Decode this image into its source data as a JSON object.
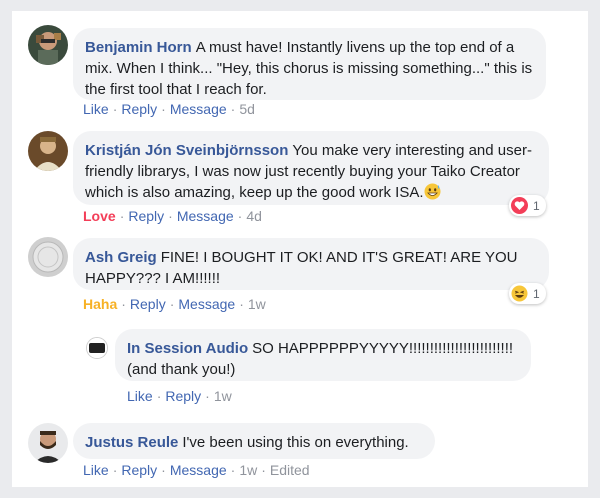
{
  "comments": [
    {
      "author": "Benjamin Horn",
      "text": "A must have! Instantly livens up the top end of a mix. When I think... \"Hey, this chorus is missing something...\" this is the first tool that I reach for.",
      "actions": {
        "like": "Like",
        "reply": "Reply",
        "message": "Message",
        "time": "5d"
      }
    },
    {
      "author": "Kristján Jón Sveinbjörnsson",
      "text": "You make very interesting and user-friendly librarys, I was now just recently buying your Taiko Creator which is also amazing, keep up the good work ISA.",
      "emoji": "grinning-sweat-emoji",
      "actions": {
        "reaction_label": "Love",
        "reply": "Reply",
        "message": "Message",
        "time": "4d"
      },
      "reaction": {
        "type": "heart-reaction-icon",
        "count": "1"
      }
    },
    {
      "author": "Ash Greig",
      "text": "FINE! I BOUGHT IT OK! AND IT'S GREAT! ARE YOU HAPPY??? I AM!!!!!!",
      "actions": {
        "reaction_label": "Haha",
        "reply": "Reply",
        "message": "Message",
        "time": "1w"
      },
      "reaction": {
        "type": "haha-reaction-icon",
        "count": "1"
      }
    },
    {
      "author": "In Session Audio",
      "avatar_text": "IN SESSION AUDIO",
      "text": "SO HAPPPPPPYYYYY!!!!!!!!!!!!!!!!!!!!!!!!! (and thank you!)",
      "actions": {
        "like": "Like",
        "reply": "Reply",
        "time": "1w"
      }
    },
    {
      "author": "Justus Reule",
      "text": "I've been using this on everything.",
      "actions": {
        "like": "Like",
        "reply": "Reply",
        "message": "Message",
        "time": "1w",
        "edited": "Edited"
      }
    }
  ],
  "colors": {
    "author": "#385898",
    "link": "#4267b2",
    "love": "#f33e58",
    "haha": "#f7b125",
    "bubble": "#f2f3f5",
    "page": "#eaebee"
  }
}
